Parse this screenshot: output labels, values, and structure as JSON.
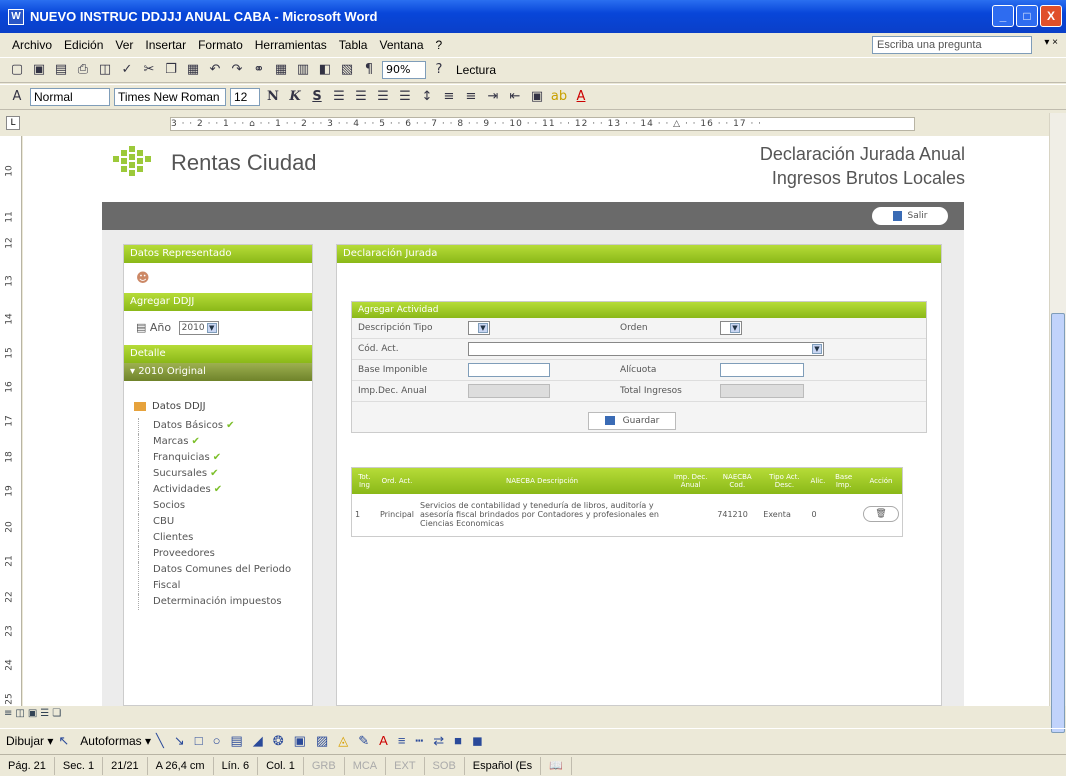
{
  "window": {
    "title": "NUEVO INSTRUC DDJJJ ANUAL CABA - Microsoft Word",
    "app_icon_label": "W",
    "minimize": "_",
    "maximize": "□",
    "close": "X"
  },
  "menu": {
    "items": [
      "Archivo",
      "Edición",
      "Ver",
      "Insertar",
      "Formato",
      "Herramientas",
      "Tabla",
      "Ventana",
      "?"
    ],
    "ask_placeholder": "Escriba una pregunta",
    "ask_arrow": "▾ ×"
  },
  "toolbar": {
    "zoom": "90%",
    "lectura": "Lectura",
    "style": "Normal",
    "font": "Times New Roman",
    "size": "12",
    "bold": "N",
    "italic": "K",
    "underline": "S"
  },
  "ruler": {
    "text": "3 · · 2 · · 1 · · ⌂ · · 1 · · 2 · · 3 · · 4 · · 5 · · 6 · · 7 · · 8 · · 9 · · 10 · · 11 · · 12 · · 13 · · 14 · · △ · · 16 · · 17 · ·",
    "tab_selector": "L",
    "vmarks": [
      "10",
      "11",
      "12",
      "13",
      "14",
      "15",
      "16",
      "17",
      "18",
      "19",
      "20",
      "21",
      "22",
      "23",
      "24",
      "25"
    ]
  },
  "page": {
    "brand": "Rentas Ciudad",
    "header_line1": "Declaración Jurada Anual",
    "header_line2": "Ingresos Brutos Locales",
    "salir": "Salir",
    "left": {
      "datos_representado": "Datos Representado",
      "agregar_ddjj": "Agregar DDJJ",
      "anio_label": "Año",
      "anio_value": "2010",
      "detalle": "Detalle",
      "detalle_sub": "▾ 2010 Original",
      "folder": "Datos DDJJ",
      "tree": [
        {
          "label": "Datos Básicos",
          "check": "✔"
        },
        {
          "label": "Marcas",
          "check": "✔"
        },
        {
          "label": "Franquicias",
          "check": "✔"
        },
        {
          "label": "Sucursales",
          "check": "✔"
        },
        {
          "label": "Actividades",
          "check": "✔"
        },
        {
          "label": "Socios",
          "check": ""
        },
        {
          "label": "CBU",
          "check": ""
        },
        {
          "label": "Clientes",
          "check": ""
        },
        {
          "label": "Proveedores",
          "check": ""
        },
        {
          "label": "Datos Comunes del Periodo Fiscal",
          "check": ""
        },
        {
          "label": "Determinación impuestos",
          "check": ""
        }
      ]
    },
    "right": {
      "title": "Declaración Jurada",
      "form_title": "Agregar Actividad",
      "descripcion_tipo": "Descripción Tipo",
      "orden": "Orden",
      "cod_act": "Cód. Act.",
      "base_imponible": "Base Imponible",
      "alicuota": "Alícuota",
      "imp_dec_anual": "Imp.Dec. Anual",
      "total_ingresos": "Total Ingresos",
      "guardar": "Guardar",
      "grid_headers": [
        "Tot. Ing",
        "Ord. Act.",
        "NAECBA Descripción",
        "Imp. Dec. Anual",
        "NAECBA Cod.",
        "Tipo Act. Desc.",
        "Alic.",
        "Base Imp.",
        "Acción"
      ],
      "grid_rows": [
        [
          "1",
          "Principal",
          "Servicios de contabilidad y teneduría de libros, auditoría y asesoría fiscal brindados por Contadores y profesionales en Ciencias Economicas",
          "",
          "741210",
          "Exenta",
          "0",
          "",
          ""
        ]
      ]
    }
  },
  "drawbar": {
    "dibujar": "Dibujar ▾",
    "autoformas": "Autoformas ▾"
  },
  "status": {
    "pag": "Pág. 21",
    "sec": "Sec. 1",
    "pages": "21/21",
    "pos": "A 26,4 cm",
    "lin": "Lín. 6",
    "col": "Col. 1",
    "grb": "GRB",
    "mca": "MCA",
    "ext": "EXT",
    "sob": "SOB",
    "lang": "Español (Es"
  }
}
